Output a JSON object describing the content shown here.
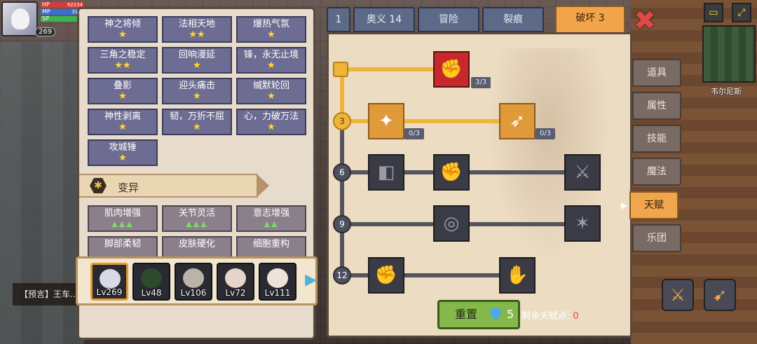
{
  "player": {
    "hp_label": "HP",
    "hp_value": "92234",
    "mp_label": "MP",
    "mp_value": "31...",
    "sp_label": "SP",
    "level": "269"
  },
  "skills": [
    {
      "name": "神之将倾",
      "stars": "★"
    },
    {
      "name": "法相天地",
      "stars": "★★"
    },
    {
      "name": "爆热气氛",
      "stars": "★"
    },
    {
      "name": "三角之稳定",
      "stars": "★★"
    },
    {
      "name": "回响漫延",
      "stars": "★"
    },
    {
      "name": "锋，永无止境",
      "stars": "★"
    },
    {
      "name": "叠影",
      "stars": "★"
    },
    {
      "name": "迎头痛击",
      "stars": "★"
    },
    {
      "name": "缄默轮回",
      "stars": "★"
    },
    {
      "name": "神性剥离",
      "stars": "★"
    },
    {
      "name": "韧，万折不屈",
      "stars": "★"
    },
    {
      "name": "心，力破万法",
      "stars": "★"
    },
    {
      "name": "攻城锤",
      "stars": "★"
    }
  ],
  "mutation": {
    "header": "变异",
    "icon": "hex-swirl-icon",
    "items": [
      {
        "name": "肌肉增强",
        "marks": "▲▲▲"
      },
      {
        "name": "关节灵活",
        "marks": "▲▲▲"
      },
      {
        "name": "意志增强",
        "marks": "▲▲"
      },
      {
        "name": "脚部柔韧",
        "marks": ""
      },
      {
        "name": "皮肤硬化",
        "marks": ""
      },
      {
        "name": "细胞重构",
        "marks": ""
      }
    ]
  },
  "party": [
    {
      "level": "Lv269",
      "selected": true
    },
    {
      "level": "Lv48",
      "selected": false
    },
    {
      "level": "Lv106",
      "selected": false
    },
    {
      "level": "Lv72",
      "selected": false
    },
    {
      "level": "Lv111",
      "selected": false
    }
  ],
  "chat": {
    "text": "【预言】王车..."
  },
  "top_tabs": [
    {
      "label": "1"
    },
    {
      "label": "奥义 14"
    },
    {
      "label": "冒险"
    },
    {
      "label": "裂痕"
    },
    {
      "label": "破坏 3",
      "active": true
    }
  ],
  "tree": {
    "tiers": [
      "",
      "3",
      "6",
      "9",
      "12"
    ],
    "talents": [
      {
        "id": "t1",
        "glyph": "✊",
        "count": "3/3",
        "state": "unlocked"
      },
      {
        "id": "t2",
        "glyph": "✦",
        "count": "0/3",
        "state": "active"
      },
      {
        "id": "t3",
        "glyph": "➶",
        "count": "0/3",
        "state": "active"
      },
      {
        "id": "t4",
        "glyph": "◧",
        "count": "",
        "state": "locked"
      },
      {
        "id": "t5",
        "glyph": "✊",
        "count": "",
        "state": "locked"
      },
      {
        "id": "t6",
        "glyph": "⚔",
        "count": "",
        "state": "locked"
      },
      {
        "id": "t7",
        "glyph": "◎",
        "count": "",
        "state": "locked"
      },
      {
        "id": "t8",
        "glyph": "✶",
        "count": "",
        "state": "locked"
      },
      {
        "id": "t9",
        "glyph": "✊",
        "count": "",
        "state": "locked"
      },
      {
        "id": "t10",
        "glyph": "✋",
        "count": "",
        "state": "locked"
      }
    ]
  },
  "side_tabs": [
    {
      "label": "道具"
    },
    {
      "label": "属性"
    },
    {
      "label": "技能"
    },
    {
      "label": "魔法"
    },
    {
      "label": "天赋",
      "active": true
    },
    {
      "label": "乐团"
    }
  ],
  "reset": {
    "label": "重置",
    "cost": "5"
  },
  "points": {
    "label": "剩余天赋点:",
    "value": "0"
  },
  "map": {
    "town": "韦尔尼斯"
  },
  "colors": {
    "accent": "#f0a64c",
    "gold_path": "#f0b43a",
    "reset_green": "#84b94a",
    "points_red": "#e84a4a"
  }
}
